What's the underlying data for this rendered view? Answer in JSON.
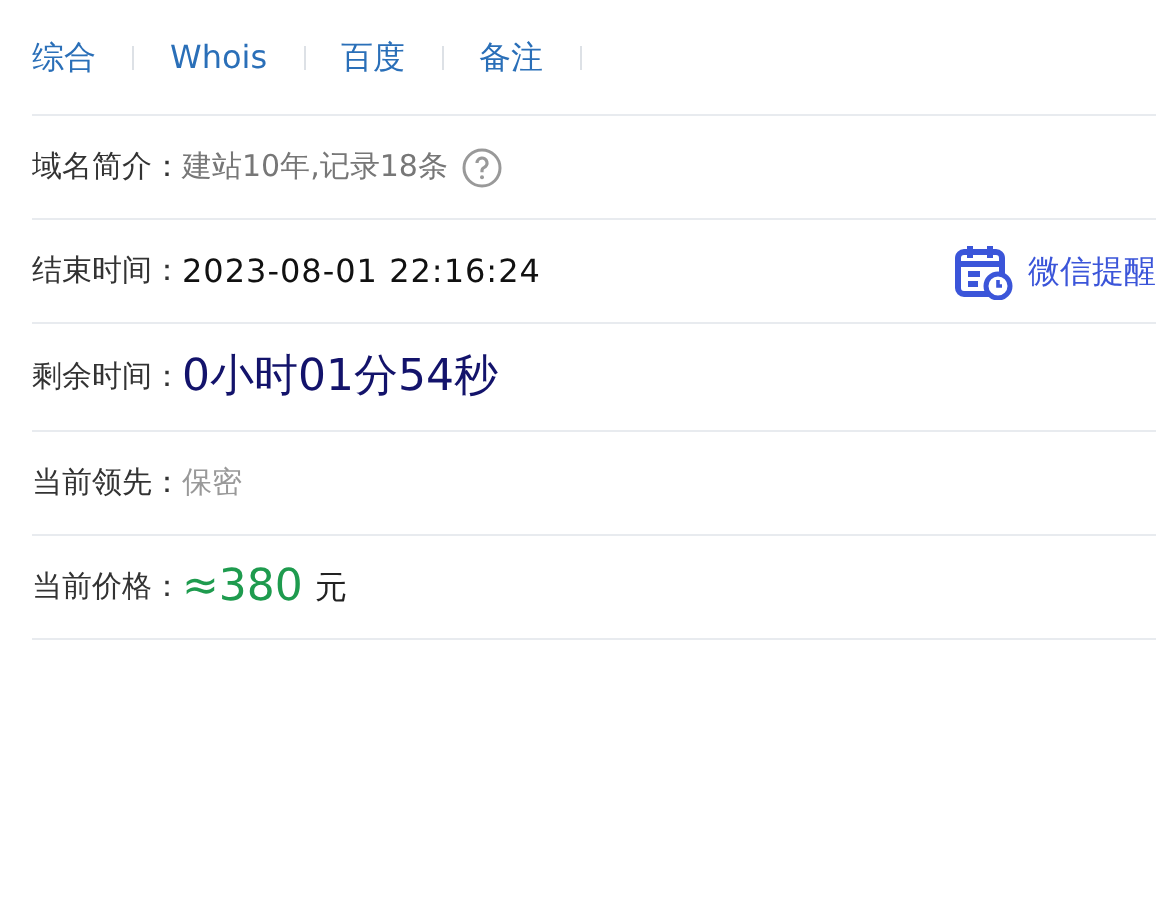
{
  "links": [
    {
      "label": "综合"
    },
    {
      "label": "Whois"
    },
    {
      "label": "百度"
    },
    {
      "label": "备注"
    }
  ],
  "rows": [
    {
      "kind": "intro",
      "label": "域名简介：",
      "value": "建站10年,记录18条"
    },
    {
      "kind": "end_time",
      "label": "结束时间：",
      "value": "2023-08-01 22:16:24",
      "action": "微信提醒"
    },
    {
      "kind": "countdown",
      "label": "剩余时间：",
      "value": "0小时01分54秒"
    },
    {
      "kind": "plain",
      "label": "当前领先：",
      "value": "保密"
    },
    {
      "kind": "price",
      "label": "当前价格：",
      "value": "≈380",
      "unit": "元"
    }
  ]
}
